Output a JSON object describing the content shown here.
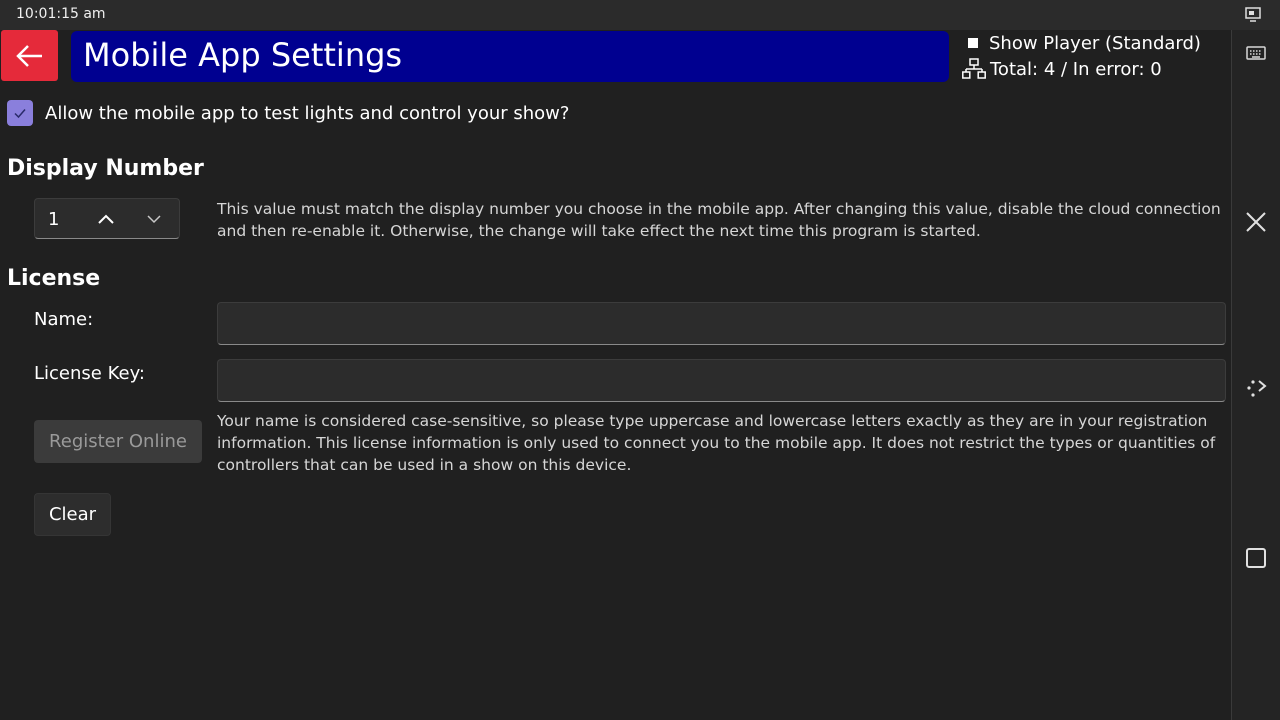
{
  "statusbar": {
    "time": "10:01:15 am",
    "icon": "screen-monitor-icon"
  },
  "header": {
    "back_icon": "arrow-left-icon",
    "title": "Mobile App Settings",
    "show_player_label": "Show Player (Standard)",
    "network_icon": "network-icon",
    "total_text": "Total: 4 / In error: 0"
  },
  "allow": {
    "checked": true,
    "label": "Allow the mobile app to test lights and control your show?"
  },
  "display_number": {
    "heading": "Display Number",
    "value": "1",
    "help": "This value must match the display number you choose in the mobile app. After changing this value, disable the cloud connection and then re-enable it. Otherwise, the change will take effect the next time this program is started."
  },
  "license": {
    "heading": "License",
    "name_label": "Name:",
    "name_value": "",
    "key_label": "License Key:",
    "key_value": "",
    "help": "Your name is considered case-sensitive, so please type uppercase and lowercase letters exactly as they are in your registration information. This license information is only used to connect you to the mobile app. It does not restrict the types or quantities of controllers that can be used in a show on this device.",
    "register_label": "Register Online",
    "clear_label": "Clear"
  },
  "sidebar": {
    "icons": [
      "keyboard-icon",
      "close-icon",
      "rotate-icon",
      "square-icon"
    ]
  },
  "colors": {
    "back_button": "#e52a3a",
    "title_bar": "#000090",
    "checkbox": "#8a7fdc",
    "background": "#202020"
  }
}
